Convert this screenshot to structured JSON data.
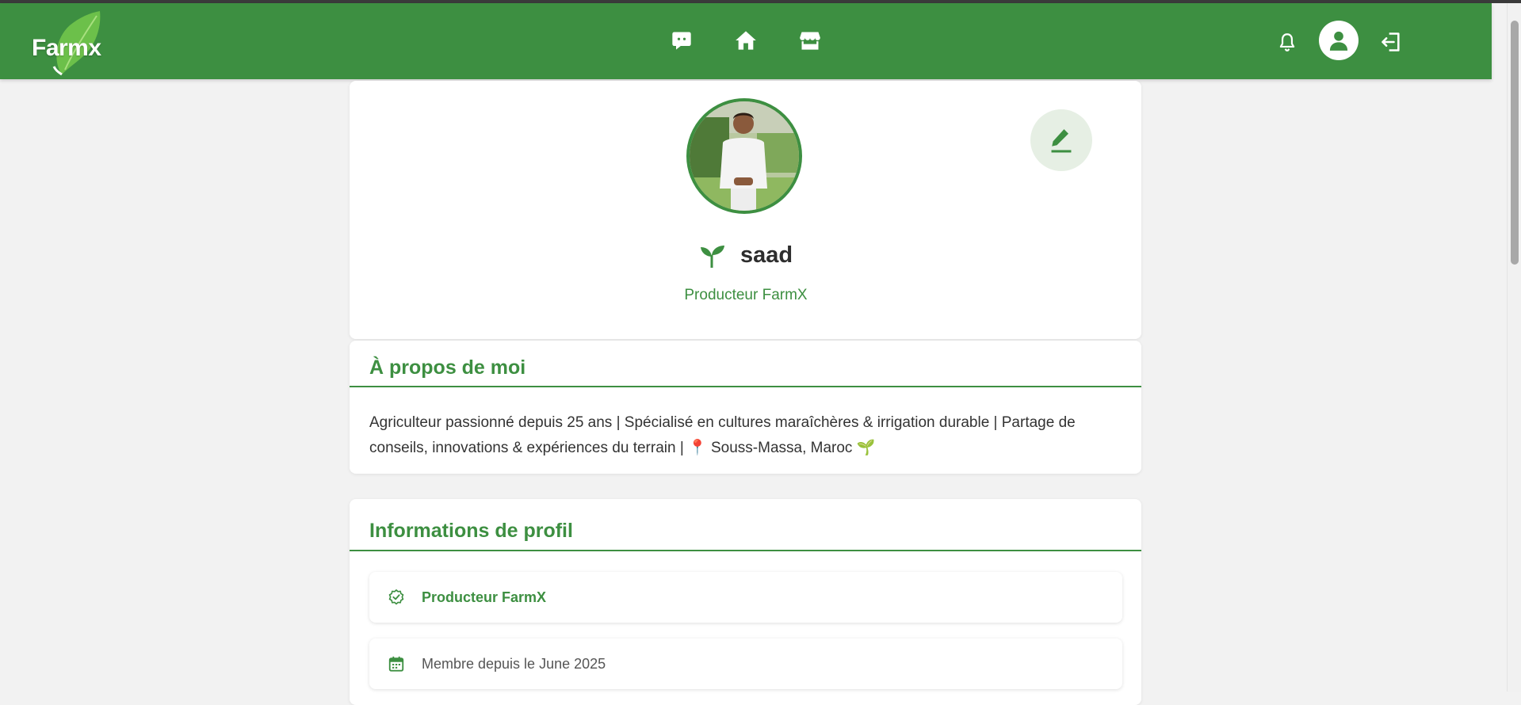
{
  "navbar": {
    "logo_text": "Farmx",
    "icons": [
      "chat-icon",
      "home-icon",
      "store-icon",
      "bell-icon",
      "user-icon",
      "logout-icon"
    ]
  },
  "profile": {
    "name": "saad",
    "role": "Producteur FarmX",
    "photo_alt": "saad"
  },
  "about": {
    "title": "À propos de moi",
    "text": "Agriculteur passionné depuis 25 ans | Spécialisé en cultures maraîchères & irrigation durable | Partage de conseils, innovations & expériences du terrain | 📍 Souss-Massa, Maroc 🌱"
  },
  "info": {
    "title": "Informations de profil",
    "items": [
      {
        "label": "Producteur FarmX",
        "icon": "verified-badge-icon"
      },
      {
        "label": "Membre depuis le June 2025",
        "icon": "calendar-icon"
      }
    ]
  },
  "colors": {
    "primary": "#3d8f41",
    "background": "#f2f2f2",
    "edit_button_bg": "#e6efe4"
  }
}
